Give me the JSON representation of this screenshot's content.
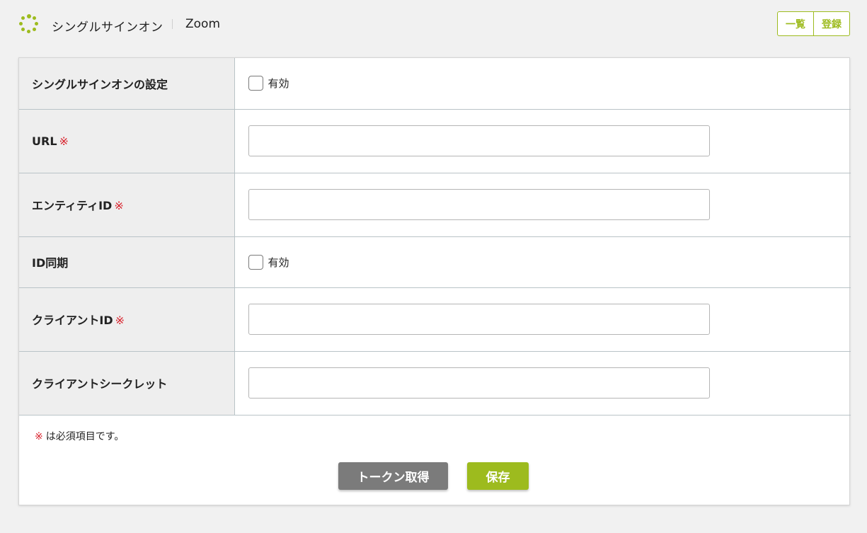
{
  "header": {
    "title": "シングルサインオン",
    "subtitle": "Zoom",
    "list_button": "一覧",
    "register_button": "登録"
  },
  "form": {
    "sso_setting": {
      "label": "シングルサインオンの設定",
      "checkbox_label": "有効",
      "checked": false
    },
    "url": {
      "label": "URL",
      "required_mark": "※",
      "value": ""
    },
    "entity_id": {
      "label": "エンティティID",
      "required_mark": "※",
      "value": ""
    },
    "id_sync": {
      "label": "ID同期",
      "checkbox_label": "有効",
      "checked": false
    },
    "client_id": {
      "label": "クライアントID",
      "required_mark": "※",
      "value": ""
    },
    "client_secret": {
      "label": "クライアントシークレット",
      "value": ""
    }
  },
  "note": {
    "mark": "※",
    "text": "は必須項目です。"
  },
  "actions": {
    "token_button": "トークン取得",
    "save_button": "保存"
  },
  "colors": {
    "accent": "#9dbb1e",
    "required": "#d9232d",
    "token_button": "#7b7b7b",
    "label_bg": "#eeeeee",
    "page_bg": "#f1f1f1"
  }
}
